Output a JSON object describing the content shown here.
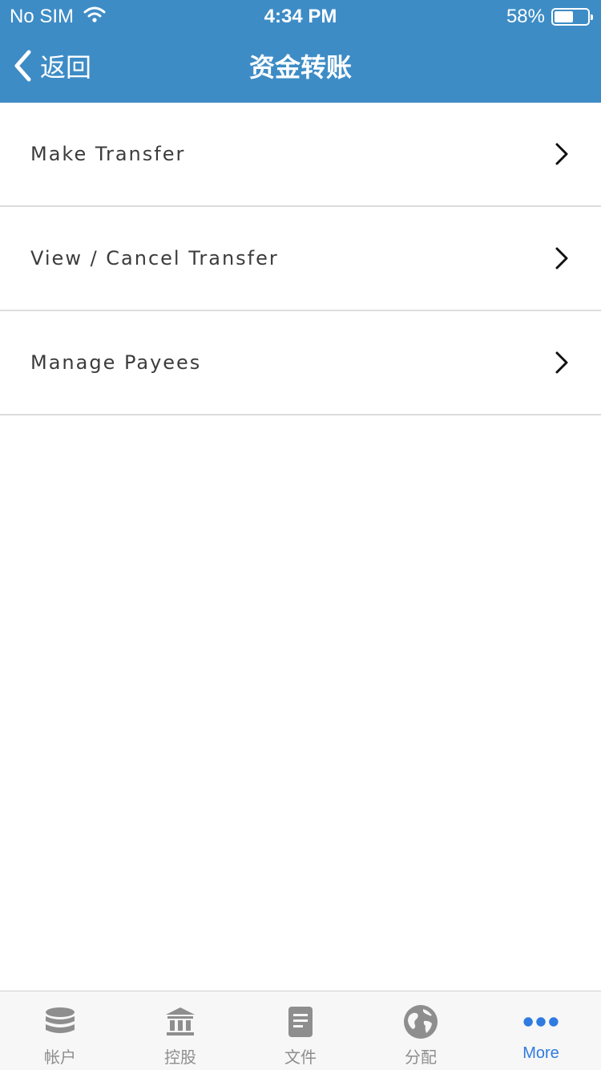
{
  "status_bar": {
    "carrier": "No SIM",
    "time": "4:34 PM",
    "battery_percent": "58%",
    "battery_level": 0.58
  },
  "nav": {
    "back_label": "返回",
    "title": "资金转账"
  },
  "menu": [
    {
      "label": "Make Transfer"
    },
    {
      "label": "View / Cancel Transfer"
    },
    {
      "label": "Manage Payees"
    }
  ],
  "tabs": [
    {
      "label": "帐户",
      "icon": "database-icon"
    },
    {
      "label": "控股",
      "icon": "bank-icon"
    },
    {
      "label": "文件",
      "icon": "document-icon"
    },
    {
      "label": "分配",
      "icon": "globe-icon"
    },
    {
      "label": "More",
      "icon": "more-dots-icon",
      "active": true
    }
  ],
  "colors": {
    "header": "#3d8cc6",
    "tab_active": "#2f7be0",
    "tab_inactive": "#8e8e8e"
  }
}
